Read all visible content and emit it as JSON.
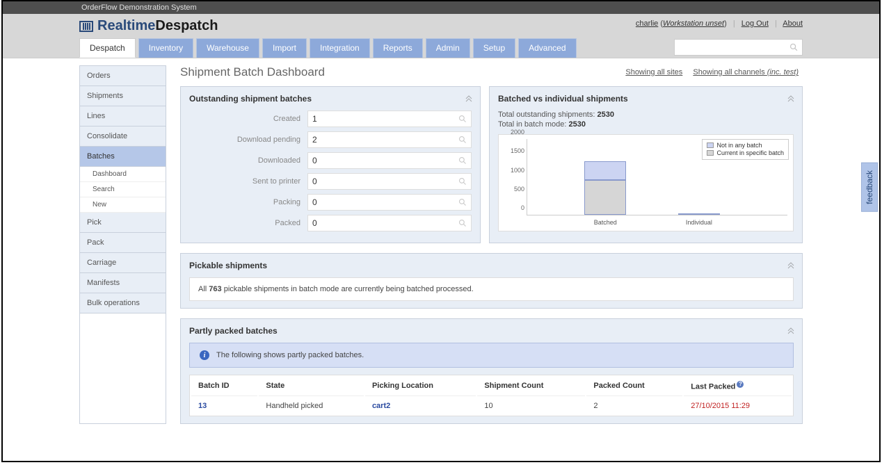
{
  "top_bar": "OrderFlow Demonstration System",
  "logo": {
    "realtime": "Realtime",
    "despatch": "Despatch"
  },
  "header": {
    "user": "charlie",
    "workstation": "Workstation unset",
    "logout": "Log Out",
    "about": "About"
  },
  "tabs": [
    "Despatch",
    "Inventory",
    "Warehouse",
    "Import",
    "Integration",
    "Reports",
    "Admin",
    "Setup",
    "Advanced"
  ],
  "active_tab": 0,
  "search_placeholder": "",
  "sidebar": {
    "items": [
      "Orders",
      "Shipments",
      "Lines",
      "Consolidate",
      "Batches",
      "Pick",
      "Pack",
      "Carriage",
      "Manifests",
      "Bulk operations"
    ],
    "selected": 4,
    "sub": [
      "Dashboard",
      "Search",
      "New"
    ]
  },
  "page_title": "Shipment Batch Dashboard",
  "title_links": {
    "sites": "Showing all sites",
    "channels": "Showing all channels ",
    "channels_suffix": "(inc. test)"
  },
  "outstanding": {
    "title": "Outstanding shipment batches",
    "rows": [
      {
        "label": "Created",
        "value": "1"
      },
      {
        "label": "Download pending",
        "value": "2"
      },
      {
        "label": "Downloaded",
        "value": "0"
      },
      {
        "label": "Sent to printer",
        "value": "0"
      },
      {
        "label": "Packing",
        "value": "0"
      },
      {
        "label": "Packed",
        "value": "0"
      }
    ]
  },
  "batched_vs": {
    "title": "Batched vs individual shipments",
    "line1_prefix": "Total outstanding shipments: ",
    "line1_value": "2530",
    "line2_prefix": "Total in batch mode: ",
    "line2_value": "2530",
    "legend": {
      "a": "Not in any batch",
      "b": "Current in specific batch"
    }
  },
  "chart_data": {
    "type": "bar",
    "categories": [
      "Batched",
      "Individual"
    ],
    "series": [
      {
        "name": "Not in any batch",
        "values": [
          550,
          30
        ],
        "color": "#ccd4f2"
      },
      {
        "name": "Current in specific batch",
        "values": [
          1000,
          0
        ],
        "color": "#d6d6d6"
      }
    ],
    "ylim": [
      0,
      2000
    ],
    "yticks": [
      0,
      500,
      1000,
      1500,
      2000
    ]
  },
  "pickable": {
    "title": "Pickable shipments",
    "msg_prefix": "All ",
    "msg_count": "763",
    "msg_suffix": " pickable shipments in batch mode are currently being batched processed."
  },
  "partly": {
    "title": "Partly packed batches",
    "banner": "The following shows partly packed batches.",
    "headers": [
      "Batch ID",
      "State",
      "Picking Location",
      "Shipment Count",
      "Packed Count",
      "Last Packed"
    ],
    "row": {
      "batch_id": "13",
      "state": "Handheld picked",
      "location": "cart2",
      "ship_count": "10",
      "packed_count": "2",
      "last_packed": "27/10/2015 11:29"
    }
  },
  "feedback": "feedback"
}
